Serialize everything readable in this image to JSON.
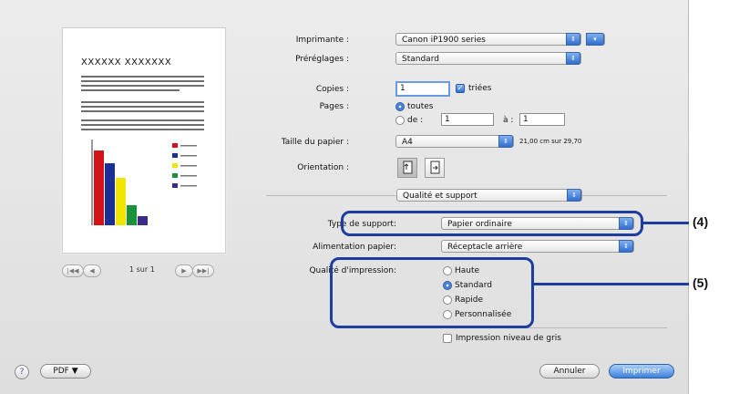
{
  "printer": {
    "label": "Imprimante :",
    "value": "Canon iP1900 series"
  },
  "presets": {
    "label": "Préréglages :",
    "value": "Standard"
  },
  "copies": {
    "label": "Copies :",
    "value": "1",
    "collated_label": "triées"
  },
  "pages": {
    "label": "Pages :",
    "all_label": "toutes",
    "from_label": "de :",
    "from_value": "1",
    "to_label": "à :",
    "to_value": "1"
  },
  "paper_size": {
    "label": "Taille du papier :",
    "value": "A4",
    "dimensions": "21,00 cm sur 29,70"
  },
  "orientation": {
    "label": "Orientation :"
  },
  "panel": {
    "value": "Qualité et support"
  },
  "media_type": {
    "label": "Type de support:",
    "value": "Papier ordinaire"
  },
  "paper_source": {
    "label": "Alimentation papier:",
    "value": "Réceptacle arrière"
  },
  "print_quality": {
    "label": "Qualité d'impression:",
    "options": [
      "Haute",
      "Standard",
      "Rapide",
      "Personnalisée"
    ],
    "selected": "Standard"
  },
  "grayscale": {
    "label": "Impression niveau de gris"
  },
  "preview": {
    "page_title": "XXXXXX XXXXXXX",
    "pager_text": "1 sur 1",
    "first_btn": "|◀◀",
    "prev_btn": "◀",
    "next_btn": "▶",
    "last_btn": "▶▶|"
  },
  "bottom": {
    "help": "?",
    "pdf": "PDF ▼",
    "cancel": "Annuler",
    "print": "Imprimer"
  },
  "callouts": {
    "c4": "(4)",
    "c5": "(5)"
  },
  "colors": {
    "accent": "#2f6fd0",
    "callout": "#1d3ea0"
  },
  "chart_bars": [
    {
      "color": "#d4121a",
      "value": 82
    },
    {
      "color": "#1c2f95",
      "value": 68
    },
    {
      "color": "#f2e600",
      "value": 52
    },
    {
      "color": "#19923a",
      "value": 22
    },
    {
      "color": "#3a2a8a",
      "value": 10
    }
  ]
}
